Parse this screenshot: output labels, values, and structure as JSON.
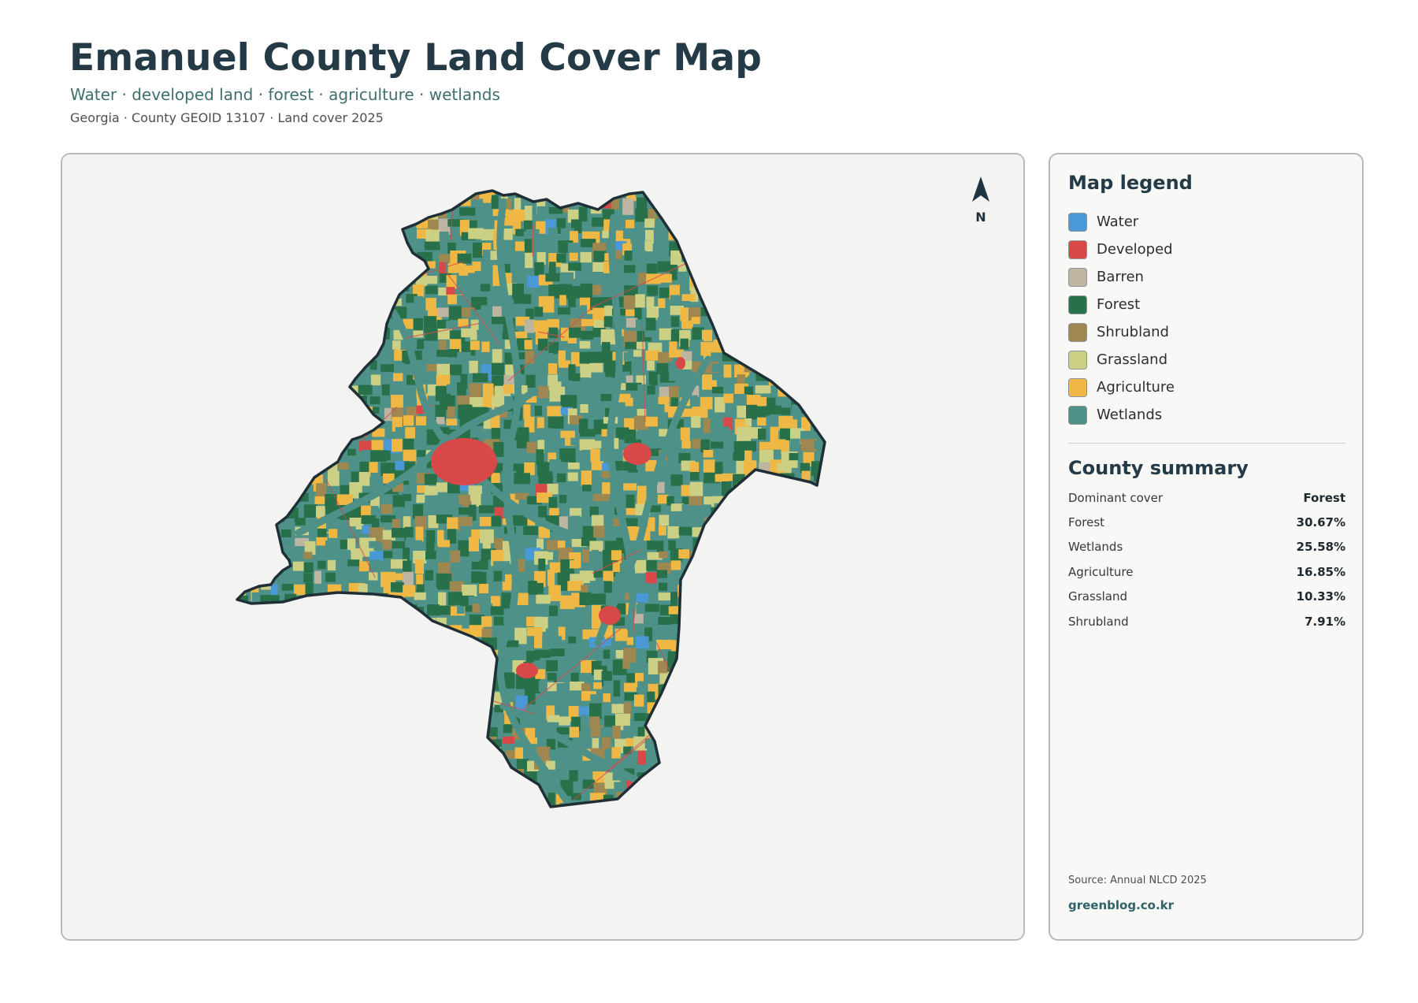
{
  "header": {
    "title": "Emanuel County Land Cover Map",
    "subtitle": "Water · developed land · forest · agriculture · wetlands",
    "meta": "Georgia · County GEOID 13107 · Land cover 2025"
  },
  "compass": {
    "label": "N",
    "icon": "north-arrow-icon"
  },
  "legend": {
    "heading": "Map legend",
    "items": [
      {
        "label": "Water",
        "color": "#4a98d6"
      },
      {
        "label": "Developed",
        "color": "#d94848"
      },
      {
        "label": "Barren",
        "color": "#bdb5a1"
      },
      {
        "label": "Forest",
        "color": "#27704a"
      },
      {
        "label": "Shrubland",
        "color": "#9e8751"
      },
      {
        "label": "Grassland",
        "color": "#ccd084"
      },
      {
        "label": "Agriculture",
        "color": "#efb844"
      },
      {
        "label": "Wetlands",
        "color": "#4e9188"
      }
    ]
  },
  "summary": {
    "heading": "County summary",
    "rows": [
      {
        "label": "Dominant cover",
        "value": "Forest"
      },
      {
        "label": "Forest",
        "value": "30.67%"
      },
      {
        "label": "Wetlands",
        "value": "25.58%"
      },
      {
        "label": "Agriculture",
        "value": "16.85%"
      },
      {
        "label": "Grassland",
        "value": "10.33%"
      },
      {
        "label": "Shrubland",
        "value": "7.91%"
      }
    ]
  },
  "footer": {
    "source": "Source: Annual NLCD 2025",
    "site": "greenblog.co.kr"
  }
}
